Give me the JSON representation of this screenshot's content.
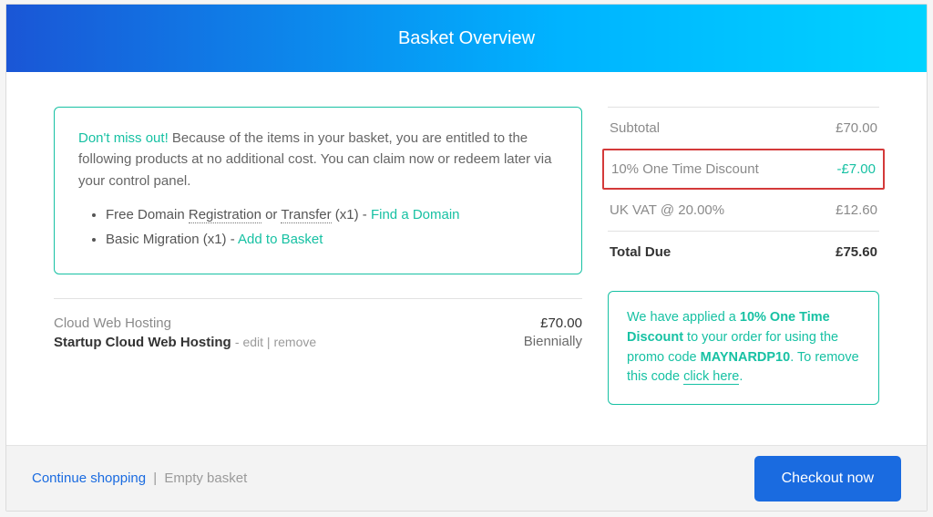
{
  "header": {
    "title": "Basket Overview"
  },
  "offer": {
    "lead": "Don't miss out!",
    "text": " Because of the items in your basket, you are entitled to the following products at no additional cost. You can claim now or redeem later via your control panel.",
    "items": [
      {
        "prefix": "Free Domain ",
        "u1": "Registration",
        "mid": " or ",
        "u2": "Transfer",
        "suffix": " (x1) - ",
        "link": "Find a Domain"
      },
      {
        "prefix": "Basic Migration (x1) - ",
        "link": "Add to Basket"
      }
    ]
  },
  "basket": {
    "category": "Cloud Web Hosting",
    "name": "Startup Cloud Web Hosting",
    "dash": " - ",
    "edit": "edit",
    "pipe": " | ",
    "remove": "remove",
    "price": "£70.00",
    "period": "Biennially"
  },
  "summary": {
    "rows": [
      {
        "label": "Subtotal",
        "value": "£70.00"
      },
      {
        "label": "10% One Time Discount",
        "value": "-£7.00",
        "discount": true
      },
      {
        "label": "UK VAT @ 20.00%",
        "value": "£12.60"
      },
      {
        "label": "Total Due",
        "value": "£75.60",
        "total": true
      }
    ]
  },
  "promo": {
    "t1": "We have applied a ",
    "b1": "10% One Time Discount",
    "t2": " to your order for using the promo code ",
    "b2": "MAYNARDP10",
    "t3": ". To remove this code ",
    "link": "click here",
    "t4": "."
  },
  "footer": {
    "continue": "Continue shopping",
    "sep": "|",
    "empty": "Empty basket",
    "checkout": "Checkout now"
  }
}
